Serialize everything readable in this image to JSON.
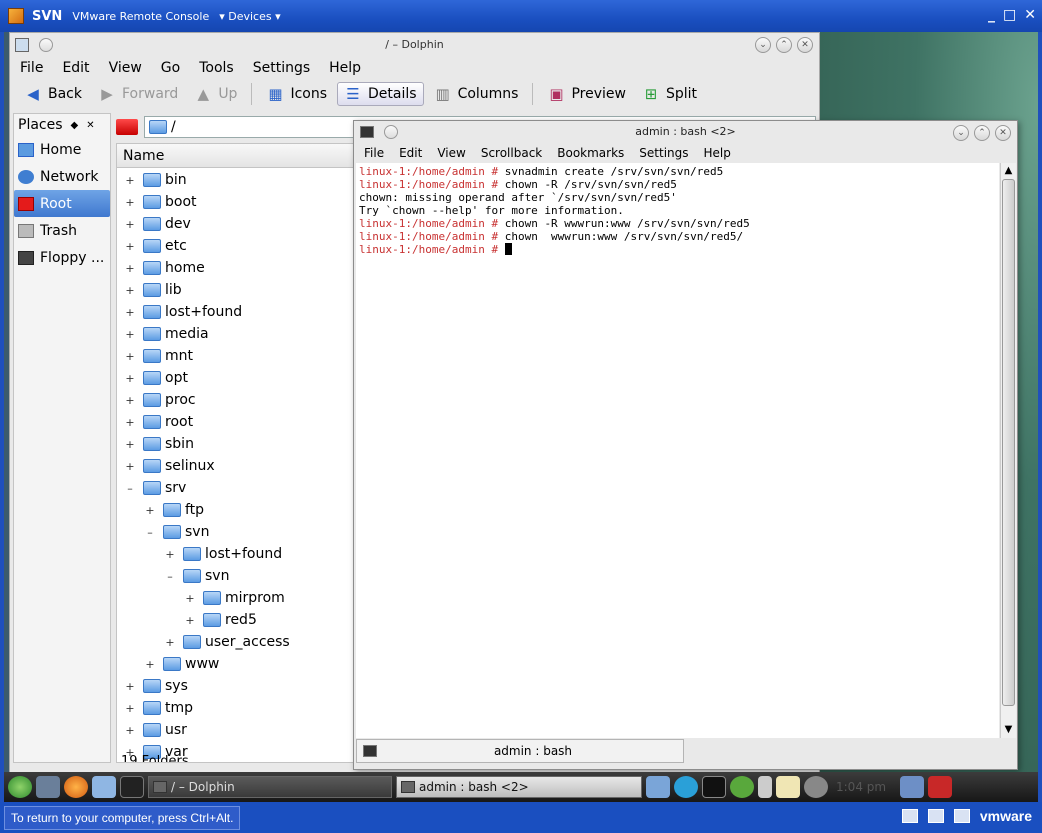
{
  "vmware": {
    "title": "SVN",
    "subtitle": "VMware Remote Console",
    "devices_label": "Devices",
    "status_hint": "To return to your computer, press Ctrl+Alt.",
    "brand": "vmware"
  },
  "dolphin": {
    "title": "/ – Dolphin",
    "menu": [
      "File",
      "Edit",
      "View",
      "Go",
      "Tools",
      "Settings",
      "Help"
    ],
    "toolbar": {
      "back": "Back",
      "forward": "Forward",
      "up": "Up",
      "icons": "Icons",
      "details": "Details",
      "columns": "Columns",
      "preview": "Preview",
      "split": "Split"
    },
    "places_title": "Places",
    "places": [
      "Home",
      "Network",
      "Root",
      "Trash",
      "Floppy ..."
    ],
    "path": "/",
    "column_header": "Name",
    "tree": [
      {
        "label": "bin",
        "exp": "+"
      },
      {
        "label": "boot",
        "exp": "+"
      },
      {
        "label": "dev",
        "exp": "+"
      },
      {
        "label": "etc",
        "exp": "+"
      },
      {
        "label": "home",
        "exp": "+"
      },
      {
        "label": "lib",
        "exp": "+"
      },
      {
        "label": "lost+found",
        "exp": "+"
      },
      {
        "label": "media",
        "exp": "+"
      },
      {
        "label": "mnt",
        "exp": "+"
      },
      {
        "label": "opt",
        "exp": "+"
      },
      {
        "label": "proc",
        "exp": "+"
      },
      {
        "label": "root",
        "exp": "+"
      },
      {
        "label": "sbin",
        "exp": "+"
      },
      {
        "label": "selinux",
        "exp": "+"
      },
      {
        "label": "srv",
        "exp": "–"
      },
      {
        "label": "ftp",
        "exp": "+"
      },
      {
        "label": "svn",
        "exp": "–"
      },
      {
        "label": "lost+found",
        "exp": "+"
      },
      {
        "label": "svn",
        "exp": "–"
      },
      {
        "label": "mirprom",
        "exp": "+"
      },
      {
        "label": "red5",
        "exp": "+"
      },
      {
        "label": "user_access",
        "exp": "+"
      },
      {
        "label": "www",
        "exp": "+"
      },
      {
        "label": "sys",
        "exp": "+"
      },
      {
        "label": "tmp",
        "exp": "+"
      },
      {
        "label": "usr",
        "exp": "+"
      },
      {
        "label": "var",
        "exp": "+"
      }
    ],
    "status": "19 Folders"
  },
  "konsole": {
    "title": "admin : bash <2>",
    "menu": [
      "File",
      "Edit",
      "View",
      "Scrollback",
      "Bookmarks",
      "Settings",
      "Help"
    ],
    "lines": [
      {
        "prompt": "linux-1:/home/admin # ",
        "text": "svnadmin create /srv/svn/svn/red5"
      },
      {
        "prompt": "linux-1:/home/admin # ",
        "text": "chown -R /srv/svn/svn/red5"
      },
      {
        "prompt": "",
        "text": "chown: missing operand after `/srv/svn/svn/red5'"
      },
      {
        "prompt": "",
        "text": "Try `chown --help' for more information."
      },
      {
        "prompt": "linux-1:/home/admin # ",
        "text": "chown -R wwwrun:www /srv/svn/svn/red5"
      },
      {
        "prompt": "linux-1:/home/admin # ",
        "text": "chown  wwwrun:www /srv/svn/svn/red5/"
      },
      {
        "prompt": "linux-1:/home/admin # ",
        "text": ""
      }
    ],
    "tab_label": "admin : bash"
  },
  "taskbar": {
    "dolphin_task": "/ – Dolphin",
    "konsole_task": "admin : bash <2>",
    "clock": "1:04 pm"
  }
}
